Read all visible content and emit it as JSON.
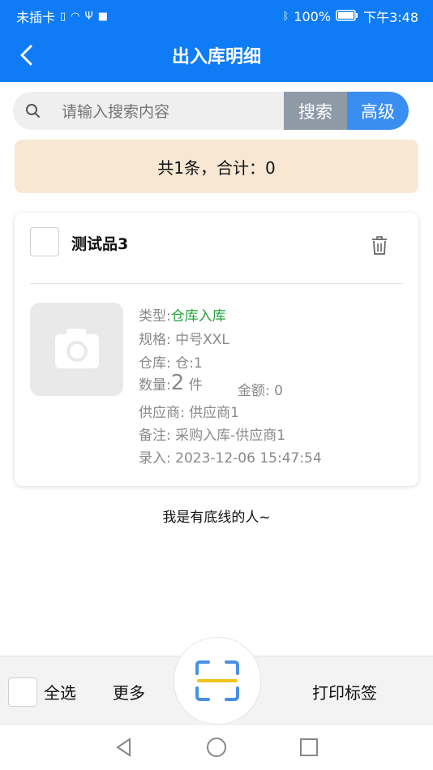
{
  "status_bar": {
    "carrier": "未插卡",
    "battery": "100%",
    "time": "下午3:48"
  },
  "nav": {
    "title": "出入库明细"
  },
  "search": {
    "placeholder": "请输入搜索内容",
    "search_label": "搜索",
    "advanced_label": "高级"
  },
  "summary": {
    "text": "共1条，合计：0"
  },
  "item": {
    "name": "测试品3",
    "type_label": "类型:",
    "type_value": "仓库入库",
    "spec": "规格: 中号XXL",
    "warehouse": "仓库: 仓:1",
    "qty_label": "数量:",
    "qty_value": "2",
    "qty_unit": "件",
    "amount": "金额: 0",
    "supplier": "供应商: 供应商1",
    "remark": "备注: 采购入库-供应商1",
    "entry": "录入: 2023-12-06 15:47:54"
  },
  "footer": {
    "text": "我是有底线的人~"
  },
  "bottom_bar": {
    "select_all": "全选",
    "more": "更多",
    "print_label": "打印标签"
  },
  "colors": {
    "primary": "#0f7cf5",
    "summary_bg": "#f8e8d3",
    "type_green": "#24a33a",
    "search_button": "#8f9aa7",
    "advanced_button": "#3a8ef2"
  }
}
